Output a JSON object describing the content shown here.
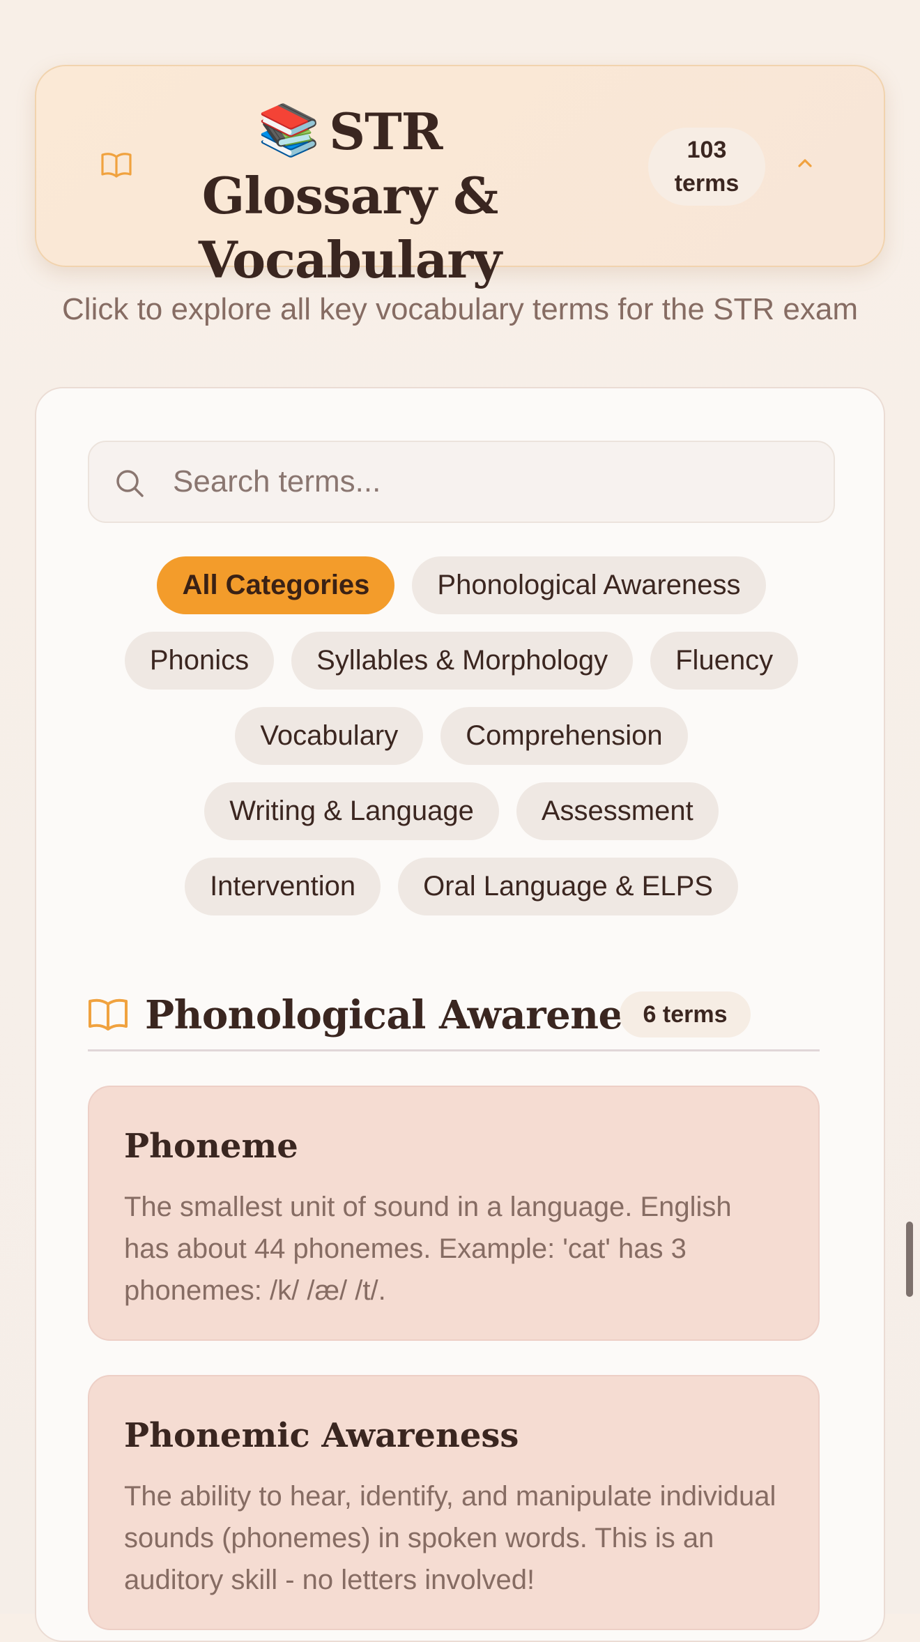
{
  "header": {
    "emoji": "📚",
    "title": "STR Glossary & Vocabulary",
    "count_number": "103",
    "count_unit": "terms",
    "book_icon": "open-book-icon",
    "collapse_icon": "chevron-up-icon"
  },
  "subtitle": "Click to explore all key vocabulary terms for the STR exam",
  "search": {
    "placeholder": "Search terms...",
    "value": "",
    "icon": "search-icon"
  },
  "categories": {
    "active": "All Categories",
    "rows": [
      [
        "All Categories",
        "Phonological Awareness"
      ],
      [
        "Phonics",
        "Syllables & Morphology",
        "Fluency"
      ],
      [
        "Vocabulary",
        "Comprehension"
      ],
      [
        "Writing & Language",
        "Assessment"
      ],
      [
        "Intervention",
        "Oral Language & ELPS"
      ]
    ]
  },
  "section": {
    "title": "Phonological Awareness",
    "count": "6 terms",
    "icon": "open-book-icon"
  },
  "terms": [
    {
      "title": "Phoneme",
      "definition": "The smallest unit of sound in a language. English has about 44 phonemes. Example: 'cat' has 3 phonemes: /k/ /æ/ /t/."
    },
    {
      "title": "Phonemic Awareness",
      "definition": "The ability to hear, identify, and manipulate individual sounds (phonemes) in spoken words. This is an auditory skill - no letters involved!"
    }
  ],
  "colors": {
    "accent": "#f39c2b",
    "term_card_bg": "#f5dcd2",
    "text_dark": "#3a2620",
    "text_muted": "#866c63"
  }
}
